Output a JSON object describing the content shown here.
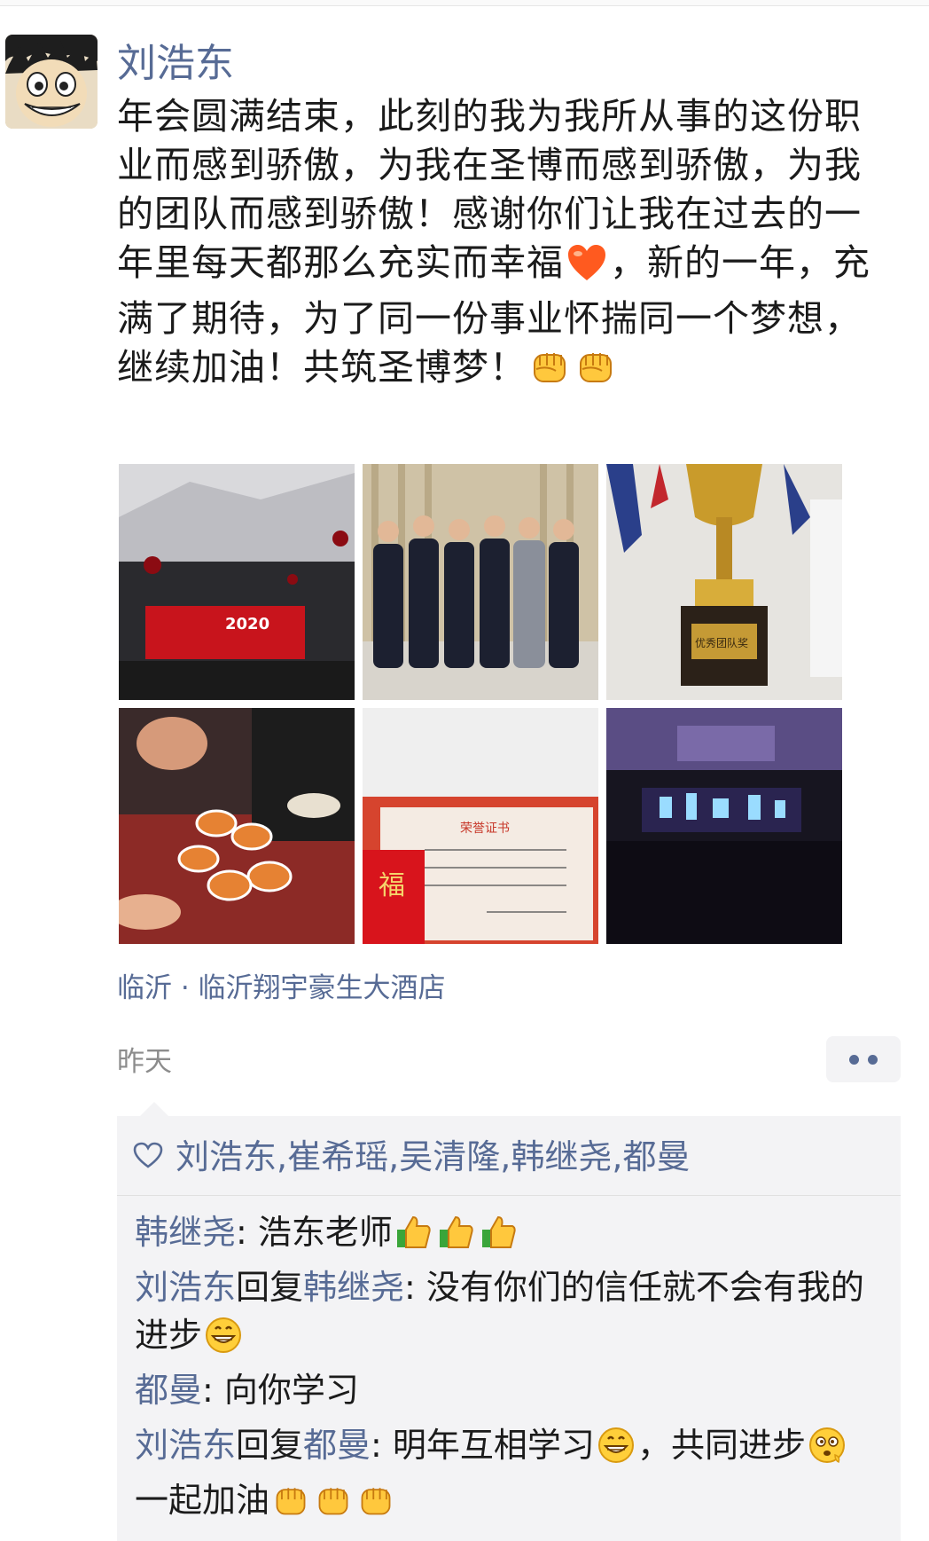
{
  "post": {
    "author": "刘浩东",
    "text_parts": [
      "年会圆满结束，此刻的我为我所从事的这份职业而感到骄傲，为我在圣博而感到骄傲，为我的团队而感到骄傲！感谢你们让我在过去的一年里每天都那么充实而幸福",
      "，新的一年，充满了期待，为了同一份事业怀揣同一个梦想，继续加油！共筑圣博梦！"
    ],
    "location": "临沂 · 临沂翔宇豪生大酒店",
    "time": "昨天"
  },
  "photos": [
    {
      "name": "photo-stage-2020",
      "overlay": "2020"
    },
    {
      "name": "photo-team-group"
    },
    {
      "name": "photo-trophy",
      "overlay": "优秀团队奖"
    },
    {
      "name": "photo-toast-cups"
    },
    {
      "name": "photo-certificate",
      "overlay": "荣誉证书"
    },
    {
      "name": "photo-concert-stage"
    }
  ],
  "likes": {
    "names": [
      "刘浩东",
      "崔希瑶",
      "吴清隆",
      "韩继尧",
      "都曼"
    ],
    "separator": ", "
  },
  "comments": [
    {
      "author": "韩继尧",
      "text": ": 浩东老师"
    },
    {
      "author": "刘浩东",
      "reply_word": "回复",
      "target": "韩继尧",
      "text": ": 没有你们的信任就不会有我的进步"
    },
    {
      "author": "都曼",
      "text": ": 向你学习"
    },
    {
      "author": "刘浩东",
      "reply_word": "回复",
      "target": "都曼",
      "text": ": 明年互相学习",
      "text2": "，共同进步",
      "text3": "一起加油"
    }
  ],
  "colors": {
    "link": "#576b95",
    "box": "#f3f3f5",
    "text": "#1b1b1b",
    "muted": "#8c8c8c"
  },
  "icons": [
    "heart-icon",
    "fist-emoji",
    "thumbs-up-emoji",
    "grin-emoji",
    "dizzy-emoji",
    "red-heart-emoji",
    "more-dots-icon"
  ]
}
